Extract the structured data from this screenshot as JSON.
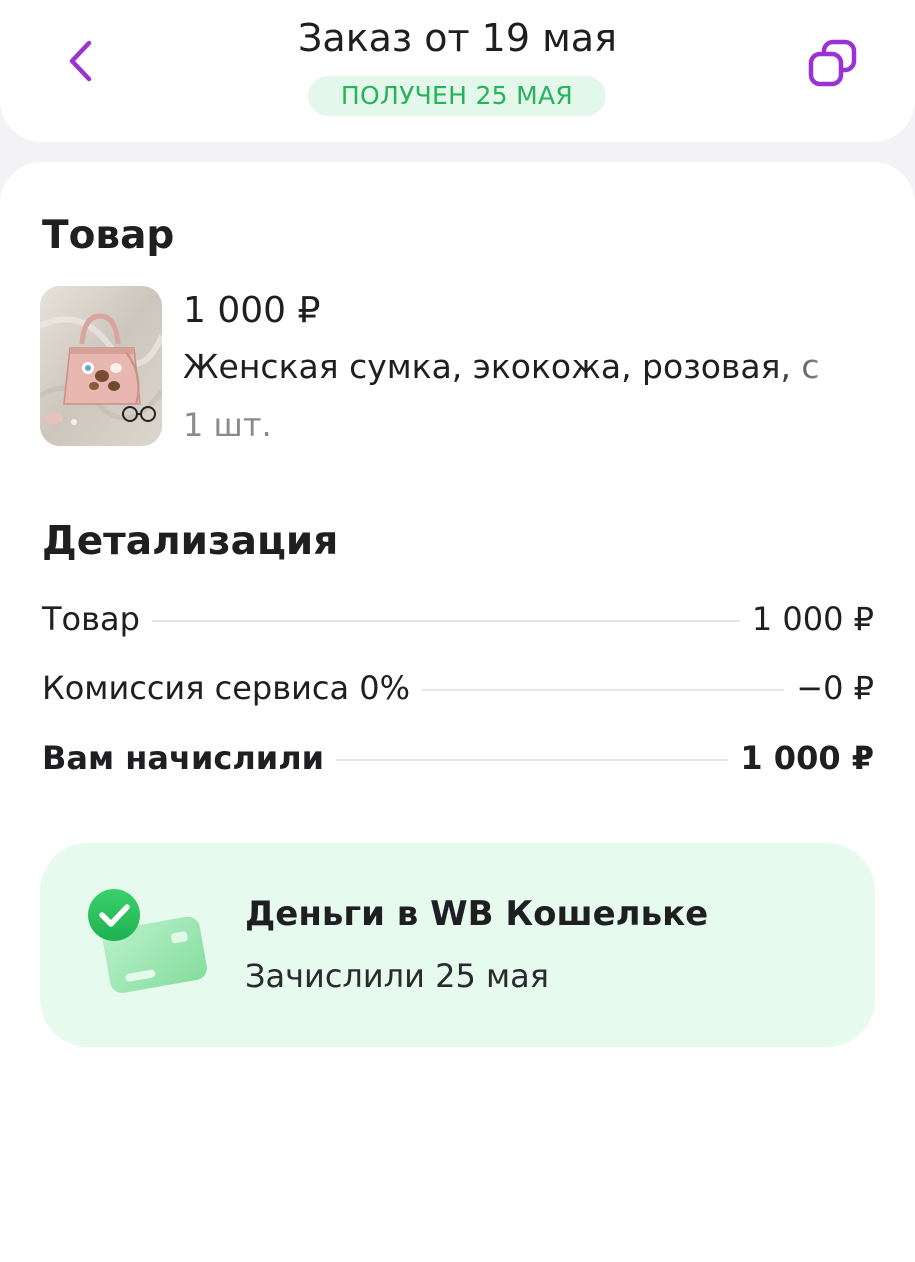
{
  "header": {
    "title": "Заказ от 19 мая",
    "status": "ПОЛУЧЕН 25 МАЯ",
    "accent_color": "#9b32d6",
    "status_color": "#26b35a",
    "back_icon": "chevron-left-icon",
    "copy_icon": "copy-icon"
  },
  "product_section": {
    "title": "Товар",
    "price": "1 000 ₽",
    "name": "Женская сумка, экокожа, розовая, с",
    "quantity": "1 шт."
  },
  "details": {
    "title": "Детализация",
    "rows": [
      {
        "label": "Товар",
        "value": "1 000 ₽"
      },
      {
        "label": "Комиссия сервиса 0%",
        "value": "−0 ₽"
      },
      {
        "label": "Вам начислили",
        "value": "1 000 ₽"
      }
    ]
  },
  "wallet": {
    "title": "Деньги в WB Кошельке",
    "subtitle": "Зачислили 25 мая",
    "icon": "wallet-card-check-icon",
    "background_color": "#e6faee"
  }
}
